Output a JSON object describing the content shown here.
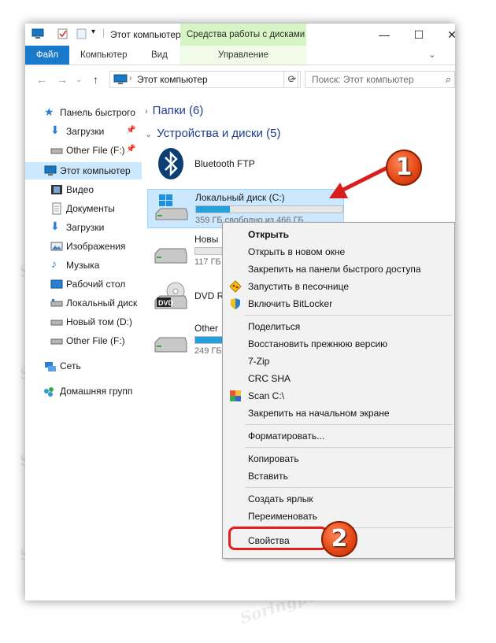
{
  "title": "Этот компьютер",
  "ribbon": {
    "tools_label": "Средства работы с дисками",
    "tabs": [
      "Файл",
      "Компьютер",
      "Вид"
    ],
    "manage_label": "Управление"
  },
  "address": {
    "path": "Этот компьютер",
    "search_placeholder": "Поиск: Этот компьютер"
  },
  "sidebar": {
    "items": [
      {
        "label": "Панель быстрого",
        "icon": "star-icon"
      },
      {
        "label": "Загрузки",
        "icon": "download-icon",
        "pinned": true
      },
      {
        "label": "Other File (F:)",
        "icon": "drive-icon",
        "pinned": true
      },
      {
        "label": "Этот компьютер",
        "icon": "computer-icon"
      },
      {
        "label": "Видео",
        "icon": "video-icon"
      },
      {
        "label": "Документы",
        "icon": "documents-icon"
      },
      {
        "label": "Загрузки",
        "icon": "download-icon"
      },
      {
        "label": "Изображения",
        "icon": "images-icon"
      },
      {
        "label": "Музыка",
        "icon": "music-icon"
      },
      {
        "label": "Рабочий стол",
        "icon": "desktop-icon"
      },
      {
        "label": "Локальный диск",
        "icon": "drive-icon"
      },
      {
        "label": "Новый том (D:)",
        "icon": "drive-icon"
      },
      {
        "label": "Other File (F:)",
        "icon": "drive-icon"
      },
      {
        "label": "Сеть",
        "icon": "network-icon"
      },
      {
        "label": "Домашняя групп",
        "icon": "homegroup-icon"
      }
    ]
  },
  "content": {
    "folders_header": "Папки (6)",
    "devices_header": "Устройства и диски (5)",
    "bluetooth": "Bluetooth FTP",
    "drives": [
      {
        "name": "Локальный диск (C:)",
        "size": "359 ГБ свободно из 466 ГБ",
        "used": 0.23
      },
      {
        "name": "Новы",
        "size": "117 ГБ",
        "used": 0.0
      },
      {
        "name": "DVD R",
        "badge": "DVD"
      },
      {
        "name": "Other",
        "size": "249 ГБ",
        "used": 0.45
      }
    ]
  },
  "context_menu": {
    "items": [
      {
        "label": "Открыть",
        "bold": true
      },
      {
        "label": "Открыть в новом окне"
      },
      {
        "label": "Закрепить на панели быстрого доступа"
      },
      {
        "label": "Запустить в песочнице",
        "icon": "sandbox-icon"
      },
      {
        "label": "Включить BitLocker",
        "icon": "shield-icon"
      },
      {
        "label": "Поделиться"
      },
      {
        "label": "Восстановить прежнюю версию"
      },
      {
        "label": "7-Zip"
      },
      {
        "label": "CRC SHA"
      },
      {
        "label": "Scan C:\\",
        "icon": "avg-icon"
      },
      {
        "label": "Закрепить на начальном экране"
      },
      {
        "label": "Форматировать..."
      },
      {
        "label": "Копировать"
      },
      {
        "label": "Вставить"
      },
      {
        "label": "Создать ярлык"
      },
      {
        "label": "Переименовать"
      },
      {
        "label": "Свойства"
      }
    ]
  },
  "annotations": {
    "step1": "1",
    "step2": "2"
  },
  "watermark": "Soringpcrepair.com",
  "colors": {
    "accent": "#1979ca",
    "selection": "#cce8ff",
    "tools_tab": "#d7f5c4",
    "badge": "#e64a19"
  }
}
